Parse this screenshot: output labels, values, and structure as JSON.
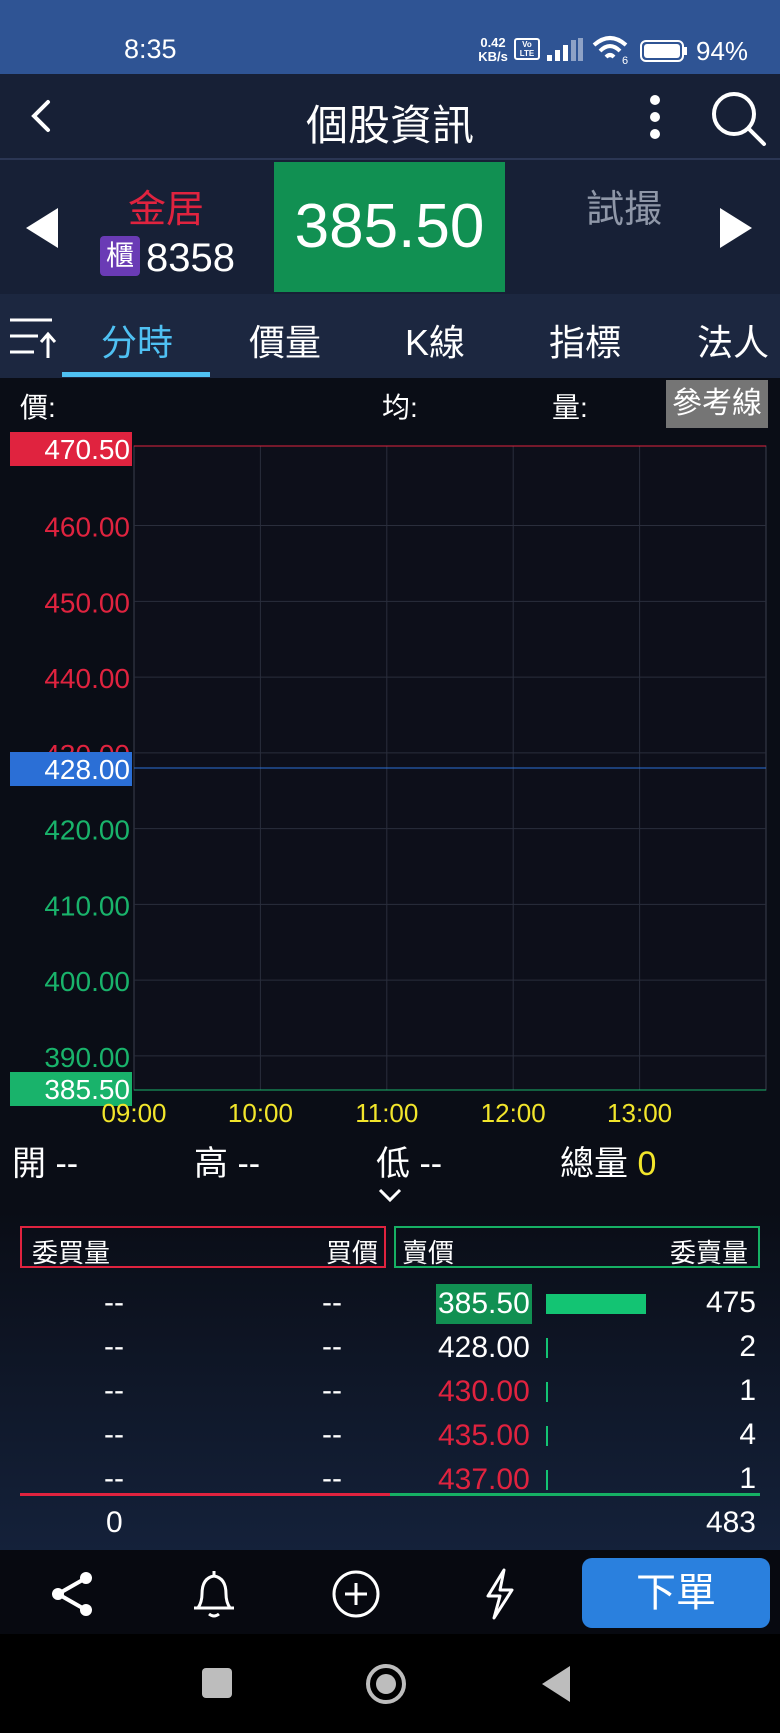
{
  "status_bar": {
    "time": "8:35",
    "net_speed_value": "0.42",
    "net_speed_unit": "KB/s",
    "volte_top": "Vo",
    "volte_bottom": "LTE",
    "wifi_badge": "6",
    "battery": "94%"
  },
  "header": {
    "title": "個股資訊"
  },
  "quote": {
    "name": "金居",
    "market_badge": "櫃",
    "code": "8358",
    "price": "385.50",
    "status": "試撮",
    "name_color": "#e0233f",
    "price_bg": "#119052"
  },
  "tabs": {
    "items": [
      {
        "label": "分時",
        "active": true
      },
      {
        "label": "價量"
      },
      {
        "label": "K線"
      },
      {
        "label": "指標"
      },
      {
        "label": "法人"
      }
    ]
  },
  "chart_header": {
    "price_label": "價:",
    "avg_label": "均:",
    "vol_label": "量:",
    "ref_button": "參考線"
  },
  "chart_data": {
    "type": "line",
    "y_ticks": [
      "470.50",
      "460.00",
      "450.00",
      "440.00",
      "430.00",
      "428.00",
      "420.00",
      "410.00",
      "400.00",
      "390.00",
      "385.50"
    ],
    "x_ticks": [
      "09:00",
      "10:00",
      "11:00",
      "12:00",
      "13:00"
    ],
    "ylim": [
      385.5,
      470.5
    ],
    "reference_price": 428.0,
    "limit_up": "470.50",
    "limit_down": "385.50",
    "series": [],
    "grid": true,
    "colors": {
      "up": "#e0233f",
      "down": "#19b36b",
      "ref": "#2b6fd6",
      "time_labels": "#f2e52b"
    }
  },
  "summary": {
    "open_label": "開",
    "open_value": "--",
    "high_label": "高",
    "high_value": "--",
    "low_label": "低",
    "low_value": "--",
    "volume_label": "總量",
    "volume_value": "0"
  },
  "order_book": {
    "bid_qty_header": "委買量",
    "bid_price_header": "買價",
    "ask_price_header": "賣價",
    "ask_qty_header": "委賣量",
    "rows": [
      {
        "bid_qty": "--",
        "bid_price": "--",
        "ask_price": "385.50",
        "ask_qty": "475",
        "ask_color": "#ffffff",
        "bar_fraction": 1.0,
        "highlight": true
      },
      {
        "bid_qty": "--",
        "bid_price": "--",
        "ask_price": "428.00",
        "ask_qty": "2",
        "ask_color": "#ffffff",
        "bar_fraction": 0.004
      },
      {
        "bid_qty": "--",
        "bid_price": "--",
        "ask_price": "430.00",
        "ask_qty": "1",
        "ask_color": "#e0233f",
        "bar_fraction": 0.002
      },
      {
        "bid_qty": "--",
        "bid_price": "--",
        "ask_price": "435.00",
        "ask_qty": "4",
        "ask_color": "#e0233f",
        "bar_fraction": 0.008
      },
      {
        "bid_qty": "--",
        "bid_price": "--",
        "ask_price": "437.00",
        "ask_qty": "1",
        "ask_color": "#e0233f",
        "bar_fraction": 0.002
      }
    ],
    "total_bid": "0",
    "total_ask": "483"
  },
  "toolbar": {
    "order_button": "下單",
    "icons": [
      "share-icon",
      "bell-icon",
      "add-circle-icon",
      "lightning-icon"
    ]
  }
}
